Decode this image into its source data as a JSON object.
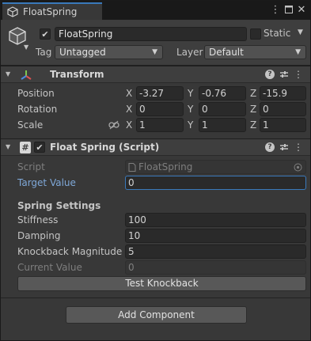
{
  "tab": {
    "title": "FloatSpring"
  },
  "object": {
    "active": true,
    "name": "FloatSpring",
    "static_label": "Static",
    "static_checked": false,
    "tag_label": "Tag",
    "tag_value": "Untagged",
    "layer_label": "Layer",
    "layer_value": "Default"
  },
  "transform": {
    "title": "Transform",
    "rows": [
      {
        "label": "Position",
        "x": "-3.27",
        "y": "-0.76",
        "z": "-15.9"
      },
      {
        "label": "Rotation",
        "x": "0",
        "y": "0",
        "z": "0"
      },
      {
        "label": "Scale",
        "x": "1",
        "y": "1",
        "z": "1"
      }
    ],
    "axes": {
      "x": "X",
      "y": "Y",
      "z": "Z"
    }
  },
  "script_component": {
    "title": "Float Spring (Script)",
    "enabled": true,
    "script_label": "Script",
    "script_value": "FloatSpring",
    "target_value_label": "Target Value",
    "target_value": "0",
    "section_title": "Spring Settings",
    "stiffness_label": "Stiffness",
    "stiffness": "100",
    "damping_label": "Damping",
    "damping": "10",
    "knockback_label": "Knockback Magnitude",
    "knockback": "5",
    "current_label": "Current Value",
    "current": "0",
    "test_button": "Test Knockback"
  },
  "add_component_label": "Add Component",
  "colors": {
    "accent": "#3a79bb",
    "panel": "#383838",
    "header": "#3e3e3e",
    "field": "#2a2a2a"
  }
}
